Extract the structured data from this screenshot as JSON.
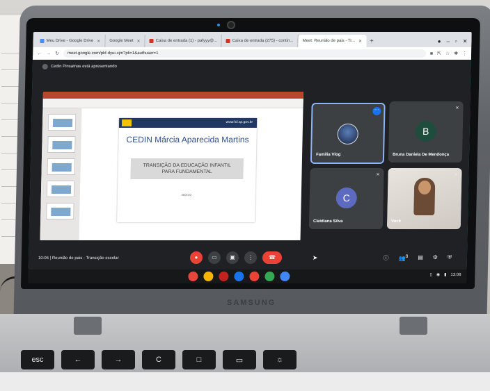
{
  "browser": {
    "tabs": [
      {
        "label": "Meu Drive - Google Drive",
        "icon": "drive-icon"
      },
      {
        "label": "Google Meet",
        "icon": "meet-icon"
      },
      {
        "label": "Caixa de entrada (1) - pafyyy@...",
        "icon": "gmail-icon"
      },
      {
        "label": "Caixa de entrada (275) - contin...",
        "icon": "gmail-icon"
      },
      {
        "label": "Meet: Reunião de pais - Tr...",
        "icon": "meet-icon",
        "active": true
      }
    ],
    "url": "meet.google.com/pkf-dyui-xjm?pli=1&authuser=1"
  },
  "meet": {
    "presenting_label": "Cedin Pinsatnas está apresentando",
    "slide": {
      "site": "www.fcl.sp.gov.br",
      "title": "CEDIN Márcia Aparecida Martins",
      "subtitle": "TRANSIÇÃO DA EDUCAÇÃO INFANTIL PARA FUNDAMENTAL",
      "date": "08/2022"
    },
    "participants": [
      {
        "name": "Familia Vlog",
        "avatar": "photo",
        "selected": true
      },
      {
        "name": "Bruna Daniela De Mendonça",
        "avatar": "B"
      },
      {
        "name": "Cleidiana Silva",
        "avatar": "C"
      },
      {
        "name": "Você",
        "avatar": "camera"
      }
    ],
    "meeting_info": "10:06  |  Reunião de pais - Transição escolar",
    "participant_count": "8"
  },
  "shelf": {
    "time": "13:08"
  },
  "laptop": {
    "brand": "SAMSUNG",
    "keys": [
      "esc",
      "←",
      "→",
      "C",
      "□",
      "▭",
      "☼"
    ]
  }
}
